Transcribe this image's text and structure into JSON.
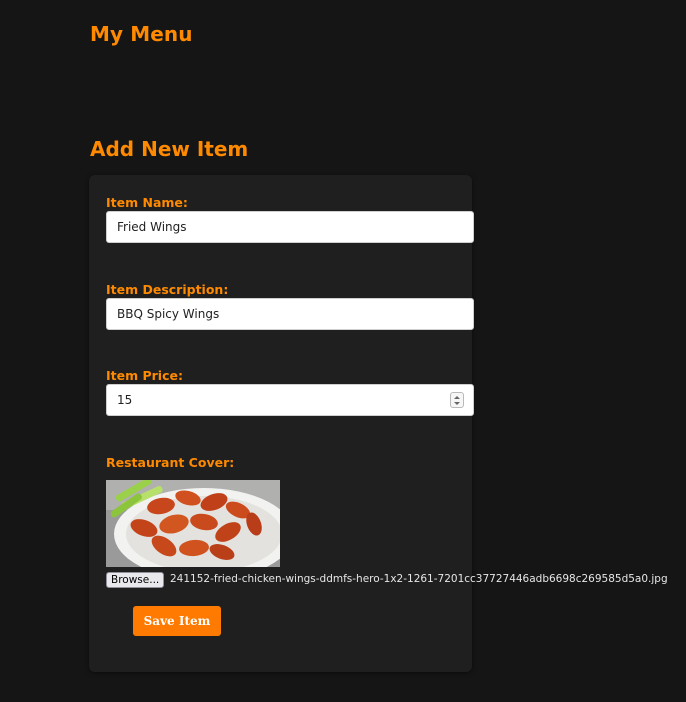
{
  "page": {
    "title": "My Menu"
  },
  "form": {
    "heading": "Add New Item",
    "item_name": {
      "label": "Item Name:",
      "value": "Fried Wings"
    },
    "item_description": {
      "label": "Item Description:",
      "value": "BBQ Spicy Wings"
    },
    "item_price": {
      "label": "Item Price:",
      "value": "15"
    },
    "cover": {
      "label": "Restaurant Cover:",
      "image_alt": "fried chicken wings photo",
      "browse_label": "Browse...",
      "file_name": "241152-fried-chicken-wings-ddmfs-hero-1x2-1261-7201cc37727446adb6698c269585d5a0.jpg"
    },
    "save_label": "Save Item"
  },
  "colors": {
    "accent": "#ff8a00",
    "button": "#ff7a00",
    "background": "#151515",
    "card": "#1f1f1f"
  }
}
